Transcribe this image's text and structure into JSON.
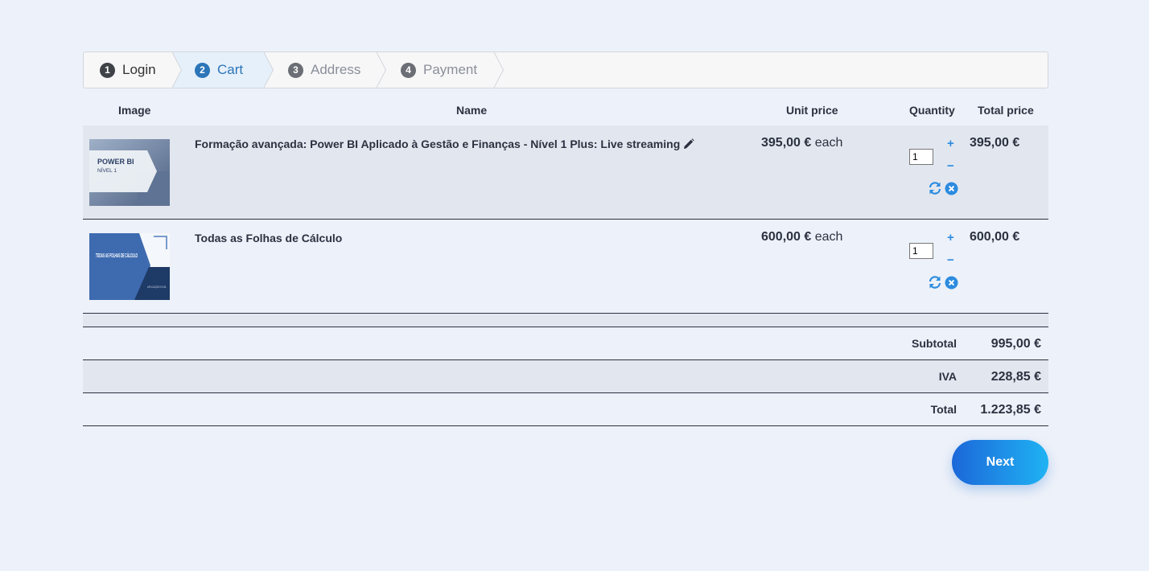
{
  "steps": [
    {
      "num": "1",
      "label": "Login"
    },
    {
      "num": "2",
      "label": "Cart"
    },
    {
      "num": "3",
      "label": "Address"
    },
    {
      "num": "4",
      "label": "Payment"
    }
  ],
  "table": {
    "headers": {
      "image": "Image",
      "name": "Name",
      "unit_price": "Unit price",
      "quantity": "Quantity",
      "total_price": "Total price"
    },
    "items": [
      {
        "name": "Formação avançada: Power BI Aplicado à Gestão e Finanças - Nível 1 Plus: Live streaming",
        "thumb_title": "POWER BI",
        "thumb_sub": "NÍVEL 1",
        "unit_price": "395,00 €",
        "each": "each",
        "quantity": "1",
        "plus": "+",
        "minus": "−",
        "total_price": "395,00 €"
      },
      {
        "name": "Todas as Folhas de Cálculo",
        "thumb_title": "TODAS AS FOLHAS DE CÁLCULO",
        "thumb_sub": "APLICAÇÃO EXCEL",
        "unit_price": "600,00 €",
        "each": "each",
        "quantity": "1",
        "plus": "+",
        "minus": "−",
        "total_price": "600,00 €"
      }
    ]
  },
  "summary": {
    "subtotal_label": "Subtotal",
    "subtotal": "995,00 €",
    "vat_label": "IVA",
    "vat": "228,85 €",
    "total_label": "Total",
    "total": "1.223,85 €"
  },
  "next_label": "Next",
  "colors": {
    "accent": "#2c75b8",
    "link": "#2c8be0",
    "button_start": "#1c67d9",
    "button_end": "#1fb3f3"
  },
  "icons": {
    "edit": "pencil-icon",
    "refresh": "refresh-icon",
    "remove": "remove-circle-icon"
  }
}
